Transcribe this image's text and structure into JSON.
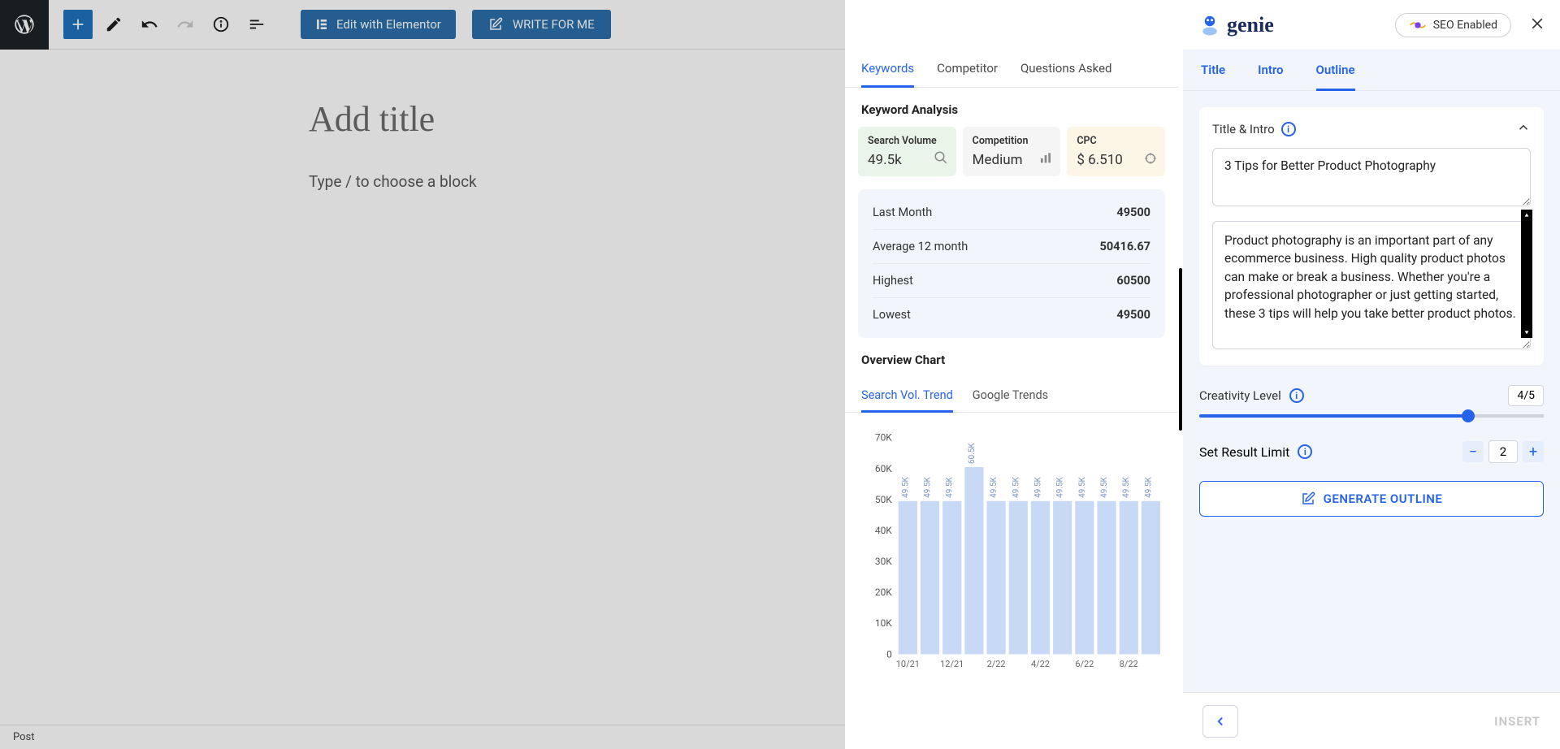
{
  "wp": {
    "elementor_label": "Edit with Elementor",
    "write_label": "WRITE FOR ME",
    "title_placeholder": "Add title",
    "block_placeholder": "Type / to choose a block",
    "bottom_status": "Post"
  },
  "kw": {
    "tabs": [
      "Keywords",
      "Competitor",
      "Questions Asked"
    ],
    "section_title": "Keyword Analysis",
    "metrics": {
      "sv_label": "Search Volume",
      "sv_value": "49.5k",
      "comp_label": "Competition",
      "comp_value": "Medium",
      "cpc_label": "CPC",
      "cpc_value": "$ 6.510"
    },
    "stats": {
      "last_month_l": "Last Month",
      "last_month_v": "49500",
      "avg_l": "Average 12 month",
      "avg_v": "50416.67",
      "high_l": "Highest",
      "high_v": "60500",
      "low_l": "Lowest",
      "low_v": "49500"
    },
    "overview_title": "Overview Chart",
    "chart_tabs": [
      "Search Vol. Trend",
      "Google Trends"
    ]
  },
  "chart_data": {
    "type": "bar",
    "title": "Search Vol. Trend",
    "ylabel": "",
    "ylim": [
      0,
      70000
    ],
    "yticks": [
      "70K",
      "60K",
      "50K",
      "40K",
      "30K",
      "20K",
      "10K",
      "0"
    ],
    "categories": [
      "10/21",
      "12/21",
      "2/22",
      "4/22",
      "6/22",
      "8/22"
    ],
    "values": [
      49500,
      49500,
      49500,
      60500,
      49500,
      49500,
      49500,
      49500,
      49500,
      49500,
      49500,
      49500
    ],
    "bar_labels": [
      "49.5K",
      "49.5K",
      "49.5K",
      "60.5K",
      "49.5K",
      "49.5K",
      "49.5K",
      "49.5K",
      "49.5K",
      "49.5K",
      "49.5K",
      "49.5K"
    ]
  },
  "outline": {
    "logo_text": "genie",
    "seo_label": "SEO Enabled",
    "steps": [
      "Title",
      "Intro",
      "Outline"
    ],
    "ti_heading": "Title & Intro",
    "title_text": "3 Tips for Better Product Photography",
    "intro_text": "Product photography is an important part of any ecommerce business. High quality product photos can make or break a business. Whether you're a professional photographer or just getting started, these 3 tips will help you take better product photos.",
    "creativity_label": "Creativity Level",
    "creativity_value": "4/5",
    "limit_label": "Set Result Limit",
    "limit_value": "2",
    "generate_label": "GENERATE OUTLINE",
    "insert_label": "INSERT"
  }
}
